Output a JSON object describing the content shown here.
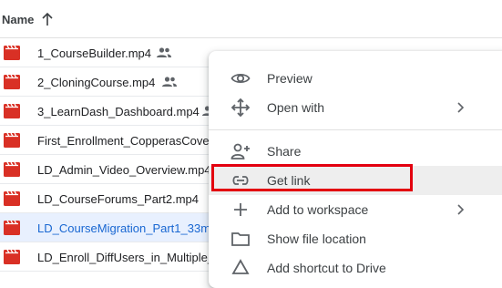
{
  "header": {
    "title": "Name",
    "sort_icon": "arrow-up-icon"
  },
  "files": [
    {
      "name": "1_CourseBuilder.mp4",
      "shared": true
    },
    {
      "name": "2_CloningCourse.mp4",
      "shared": true
    },
    {
      "name": "3_LearnDash_Dashboard.mp4",
      "shared": true
    },
    {
      "name": "First_Enrollment_CopperasCove",
      "shared": false
    },
    {
      "name": "LD_Admin_Video_Overview.mp4",
      "shared": false
    },
    {
      "name": "LD_CourseForums_Part2.mp4",
      "shared": false
    },
    {
      "name": "LD_CourseMigration_Part1_33m",
      "shared": false,
      "selected": true
    },
    {
      "name": "LD_Enroll_DiffUsers_in_Multiple_",
      "shared": false
    }
  ],
  "context_menu": {
    "items": [
      {
        "label": "Preview",
        "icon": "eye-icon",
        "submenu": false
      },
      {
        "label": "Open with",
        "icon": "move-arrows-icon",
        "submenu": true
      },
      {
        "label": "Share",
        "icon": "person-add-icon",
        "submenu": false
      },
      {
        "label": "Get link",
        "icon": "link-icon",
        "submenu": false,
        "highlighted": true
      },
      {
        "label": "Add to workspace",
        "icon": "plus-icon",
        "submenu": true
      },
      {
        "label": "Show file location",
        "icon": "folder-icon",
        "submenu": false
      },
      {
        "label": "Add shortcut to Drive",
        "icon": "drive-shortcut-icon",
        "submenu": false
      }
    ]
  },
  "colors": {
    "file_icon": "#d93025",
    "selected_row_bg": "#e8f0fe",
    "selected_text": "#1967d2",
    "highlight_border": "#e3000f"
  }
}
